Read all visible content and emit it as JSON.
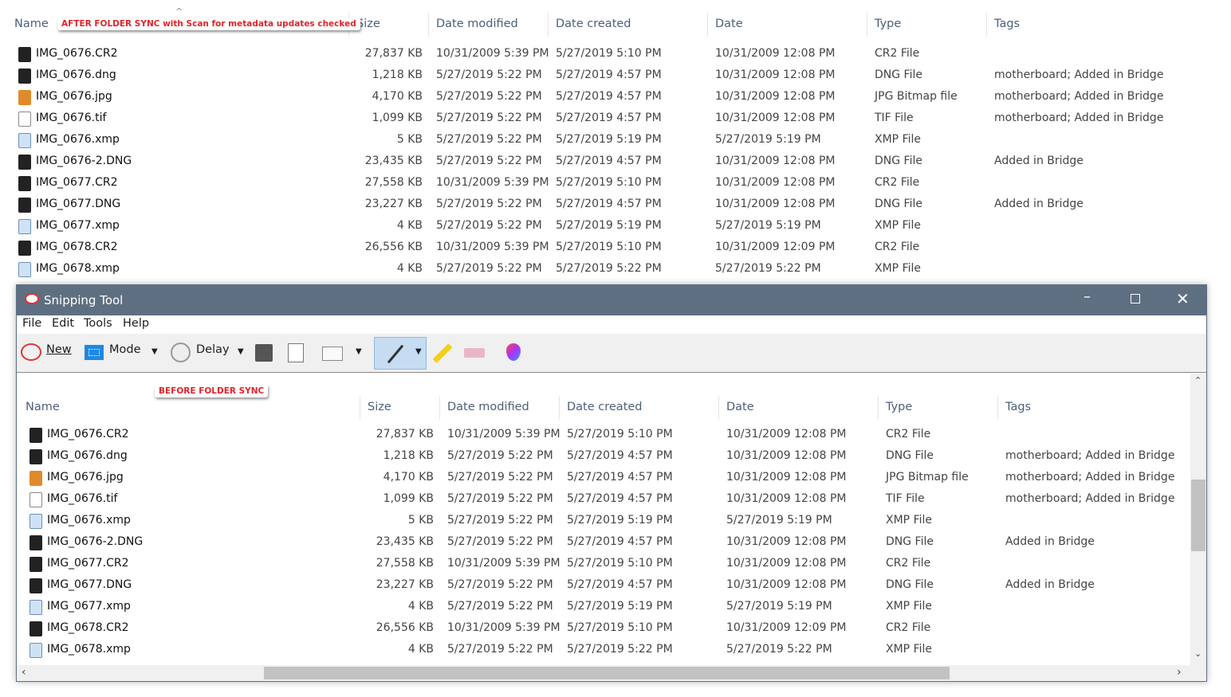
{
  "top": {
    "note": "AFTER FOLDER SYNC with Scan for metadata updates checked"
  },
  "bottom": {
    "note": "BEFORE FOLDER SYNC"
  },
  "columns": {
    "name": "Name",
    "size": "Size",
    "date_modified": "Date modified",
    "date_created": "Date created",
    "date": "Date",
    "type": "Type",
    "tags": "Tags"
  },
  "files": [
    {
      "name": "IMG_0676.CR2",
      "icon": "raw",
      "size": "27,837 KB",
      "modified": "10/31/2009 5:39 PM",
      "created": "5/27/2019 5:10 PM",
      "date": "10/31/2009 12:08 PM",
      "type": "CR2 File",
      "tags": ""
    },
    {
      "name": "IMG_0676.dng",
      "icon": "raw",
      "size": "1,218 KB",
      "modified": "5/27/2019 5:22 PM",
      "created": "5/27/2019 4:57 PM",
      "date": "10/31/2009 12:08 PM",
      "type": "DNG File",
      "tags": "motherboard; Added in Bridge"
    },
    {
      "name": "IMG_0676.jpg",
      "icon": "jpg",
      "size": "4,170 KB",
      "modified": "5/27/2019 5:22 PM",
      "created": "5/27/2019 4:57 PM",
      "date": "10/31/2009 12:08 PM",
      "type": "JPG Bitmap file",
      "tags": "motherboard; Added in Bridge"
    },
    {
      "name": "IMG_0676.tif",
      "icon": "tif",
      "size": "1,099 KB",
      "modified": "5/27/2019 5:22 PM",
      "created": "5/27/2019 4:57 PM",
      "date": "10/31/2009 12:08 PM",
      "type": "TIF File",
      "tags": "motherboard; Added in Bridge"
    },
    {
      "name": "IMG_0676.xmp",
      "icon": "xmp",
      "size": "5 KB",
      "modified": "5/27/2019 5:22 PM",
      "created": "5/27/2019 5:19 PM",
      "date": "5/27/2019 5:19 PM",
      "type": "XMP File",
      "tags": ""
    },
    {
      "name": "IMG_0676-2.DNG",
      "icon": "raw",
      "size": "23,435 KB",
      "modified": "5/27/2019 5:22 PM",
      "created": "5/27/2019 4:57 PM",
      "date": "10/31/2009 12:08 PM",
      "type": "DNG File",
      "tags": "Added in Bridge"
    },
    {
      "name": "IMG_0677.CR2",
      "icon": "raw",
      "size": "27,558 KB",
      "modified": "10/31/2009 5:39 PM",
      "created": "5/27/2019 5:10 PM",
      "date": "10/31/2009 12:08 PM",
      "type": "CR2 File",
      "tags": ""
    },
    {
      "name": "IMG_0677.DNG",
      "icon": "raw",
      "size": "23,227 KB",
      "modified": "5/27/2019 5:22 PM",
      "created": "5/27/2019 4:57 PM",
      "date": "10/31/2009 12:08 PM",
      "type": "DNG File",
      "tags": "Added in Bridge"
    },
    {
      "name": "IMG_0677.xmp",
      "icon": "xmp",
      "size": "4 KB",
      "modified": "5/27/2019 5:22 PM",
      "created": "5/27/2019 5:19 PM",
      "date": "5/27/2019 5:19 PM",
      "type": "XMP File",
      "tags": ""
    },
    {
      "name": "IMG_0678.CR2",
      "icon": "raw",
      "size": "26,556 KB",
      "modified": "10/31/2009 5:39 PM",
      "created": "5/27/2019 5:10 PM",
      "date": "10/31/2009 12:09 PM",
      "type": "CR2 File",
      "tags": ""
    },
    {
      "name": "IMG_0678.xmp",
      "icon": "xmp",
      "size": "4 KB",
      "modified": "5/27/2019 5:22 PM",
      "created": "5/27/2019 5:22 PM",
      "date": "5/27/2019 5:22 PM",
      "type": "XMP File",
      "tags": ""
    }
  ],
  "window": {
    "title": "Snipping Tool",
    "menu": [
      "File",
      "Edit",
      "Tools",
      "Help"
    ],
    "toolbar": {
      "new": "New",
      "mode": "Mode",
      "delay": "Delay"
    }
  }
}
